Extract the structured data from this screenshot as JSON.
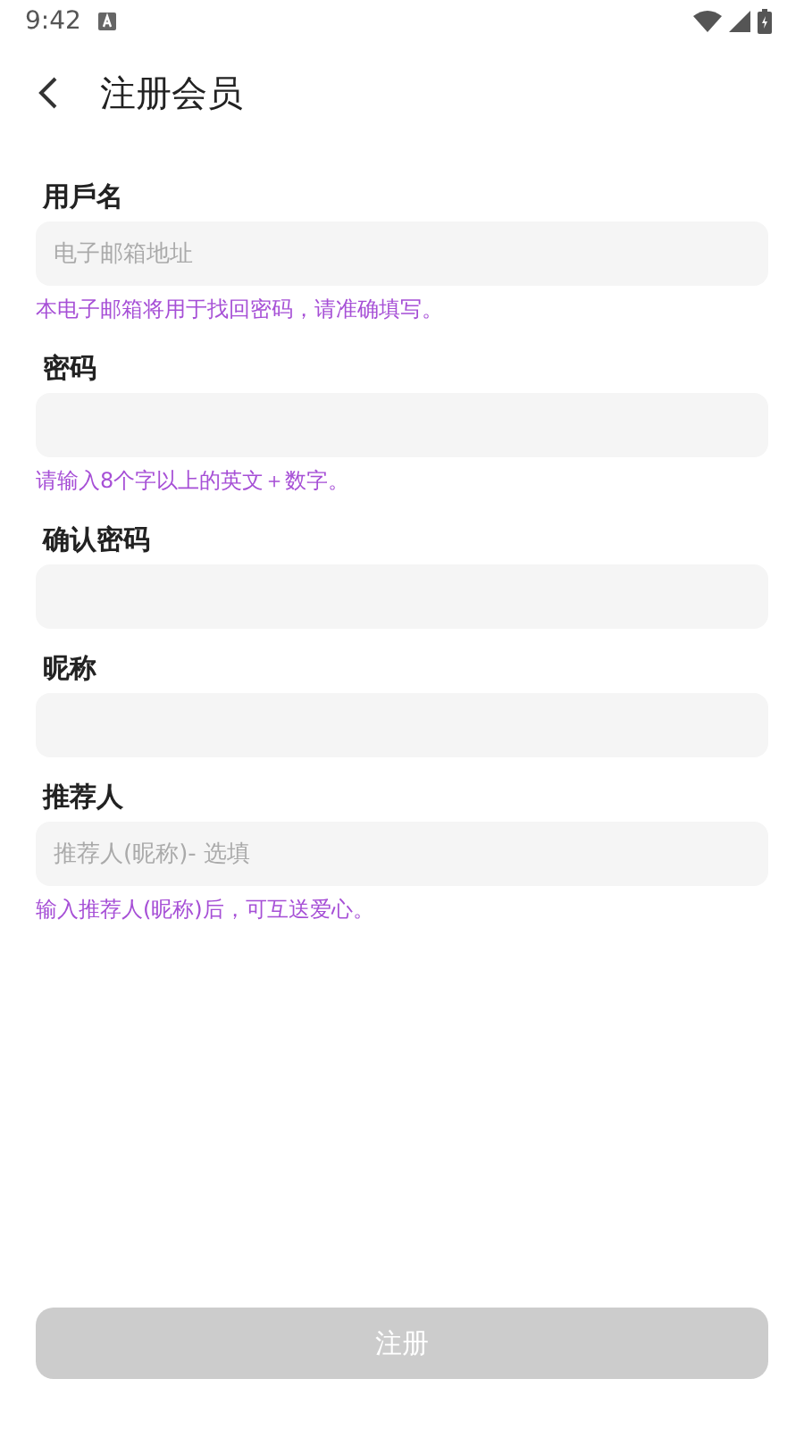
{
  "status_bar": {
    "time": "9:42"
  },
  "header": {
    "title": "注册会员"
  },
  "fields": [
    {
      "label": "用戶名",
      "placeholder": "电子邮箱地址",
      "hint": "本电子邮箱将用于找回密码，请准确填写。"
    },
    {
      "label": "密码",
      "hint": "请输入8个字以上的英文＋数字。"
    },
    {
      "label": "确认密码"
    },
    {
      "label": "昵称"
    },
    {
      "label": "推荐人",
      "placeholder": "推荐人(昵称)- 选填",
      "hint": "输入推荐人(昵称)后，可互送爱心。"
    }
  ],
  "submit": {
    "label": "注册",
    "disabled": true
  }
}
